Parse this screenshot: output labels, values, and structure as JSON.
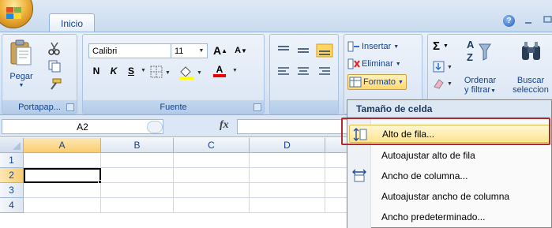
{
  "tabs": {
    "home": "Inicio"
  },
  "window": {
    "help": "?"
  },
  "ribbon": {
    "clipboard": {
      "label": "Portapap...",
      "paste": "Pegar"
    },
    "font": {
      "label": "Fuente",
      "family": "Calibri",
      "size": "11",
      "grow": "A",
      "shrink": "A",
      "bold": "N",
      "italic": "K",
      "underline": "S",
      "font_color_letter": "A"
    },
    "cells": {
      "insert": "Insertar",
      "delete": "Eliminar",
      "format": "Formato"
    },
    "editing": {
      "sigma": "Σ",
      "sort_line1": "Ordenar",
      "sort_line2": "y filtrar",
      "find_line1": "Buscar",
      "find_line2": "seleccion"
    }
  },
  "formula_bar": {
    "name_box": "A2",
    "fx": "fx"
  },
  "sheet": {
    "columns": [
      "A",
      "B",
      "C",
      "D"
    ],
    "rows": [
      "1",
      "2",
      "3",
      "4"
    ],
    "active_cell": "A2"
  },
  "menu": {
    "header": "Tamaño de celda",
    "items": [
      {
        "label": "Alto de fila...",
        "highlighted": true
      },
      {
        "label": "Autoajustar alto de fila"
      },
      {
        "label": "Ancho de columna..."
      },
      {
        "label": "Autoajustar ancho de columna"
      },
      {
        "label": "Ancho predeterminado..."
      }
    ]
  },
  "colors": {
    "accent_outline": "#b02b2b",
    "highlight": "#ffe58f",
    "ribbon_text": "#15428b"
  }
}
